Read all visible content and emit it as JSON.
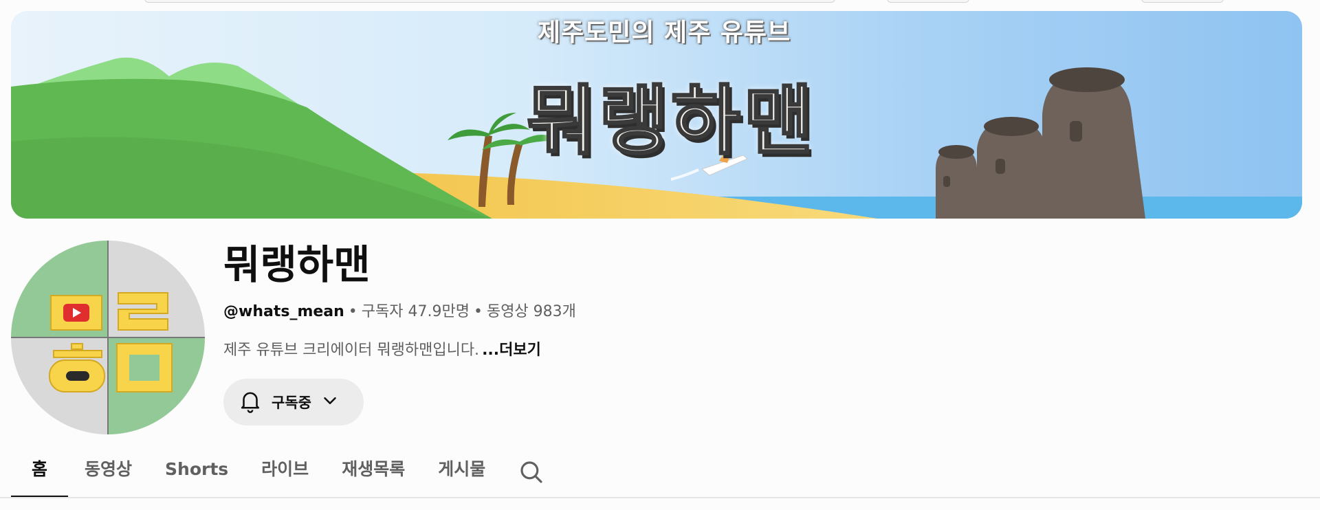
{
  "banner": {
    "subtitle": "제주도민의 제주 유튜브",
    "title": "뭐랭하맨"
  },
  "avatar": {
    "letters": [
      "ㅁ",
      "ㄹ",
      "ㅎ",
      "ㅁ"
    ],
    "colors": {
      "green": "#93c997",
      "gray": "#d9d9d9",
      "yellow": "#f8d44a",
      "red": "#e02d2d"
    }
  },
  "channel": {
    "name": "뭐랭하맨",
    "handle": "@whats_mean",
    "separator": "•",
    "subscribers": "구독자 47.9만명",
    "videos": "동영상 983개",
    "description": "제주 유튜브 크리에이터 뭐랭하맨입니다.",
    "more": "...더보기"
  },
  "subscribe_button": {
    "label": "구독중",
    "icon": "bell-icon",
    "dropdown_icon": "chevron-down-icon"
  },
  "tabs": [
    {
      "label": "홈",
      "active": true
    },
    {
      "label": "동영상",
      "active": false
    },
    {
      "label": "Shorts",
      "active": false
    },
    {
      "label": "라이브",
      "active": false
    },
    {
      "label": "재생목록",
      "active": false
    },
    {
      "label": "게시물",
      "active": false
    }
  ],
  "search_icon": "search-icon"
}
